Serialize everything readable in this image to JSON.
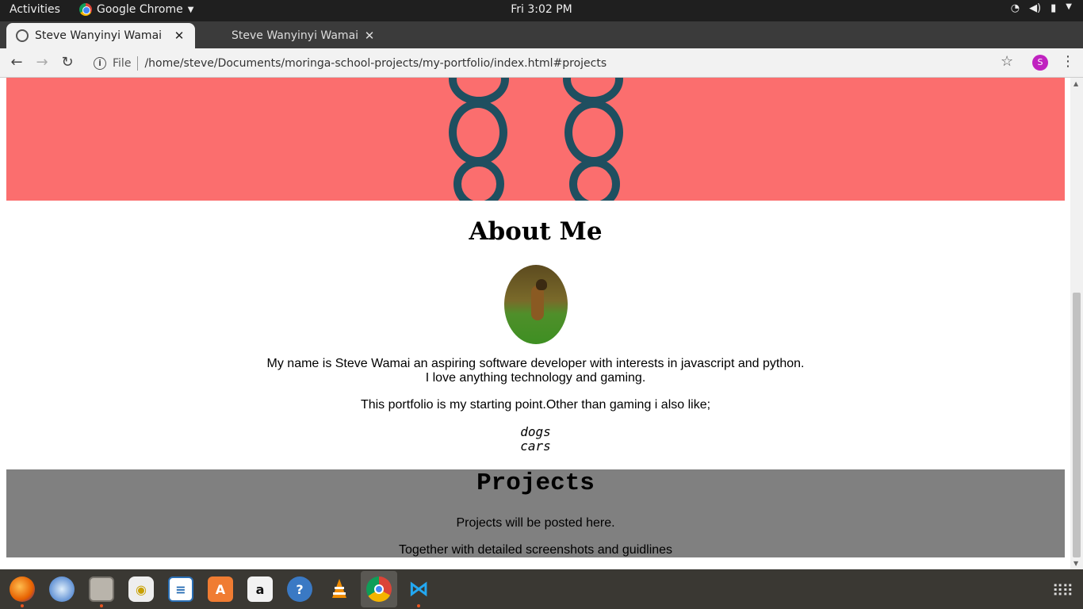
{
  "system_bar": {
    "activities": "Activities",
    "app_name": "Google Chrome",
    "clock": "Fri  3:02 PM"
  },
  "tabs": [
    {
      "title": "Steve Wanyinyi Wamai",
      "active": true
    },
    {
      "title": "Steve Wanyinyi Wamai",
      "active": false
    }
  ],
  "toolbar": {
    "scheme_label": "File",
    "url": "/home/steve/Documents/moringa-school-projects/my-portfolio/index.html#projects",
    "avatar_letter": "S"
  },
  "page": {
    "about": {
      "heading": "About Me",
      "intro_line1": "My name is Steve Wamai an aspiring software developer with interests in javascript and python.",
      "intro_line2": "I love anything technology and gaming.",
      "likes_intro": "This portfolio is my starting point.Other than gaming i also like;",
      "likes": [
        "dogs",
        "cars"
      ]
    },
    "projects": {
      "heading": "Projects",
      "line1": "Projects will be posted here.",
      "line2": "Together with detailed screenshots and guidlines"
    }
  },
  "dock": {
    "apps": [
      "firefox-icon",
      "thunderbird-icon",
      "files-icon",
      "rhythmbox-icon",
      "libreoffice-writer-icon",
      "software-center-icon",
      "amazon-icon",
      "help-icon",
      "vlc-icon",
      "chrome-icon",
      "vscode-icon"
    ]
  },
  "colors": {
    "hero_bg": "#fb6e6e",
    "projects_bg": "#808080",
    "accent": "#e95420"
  }
}
